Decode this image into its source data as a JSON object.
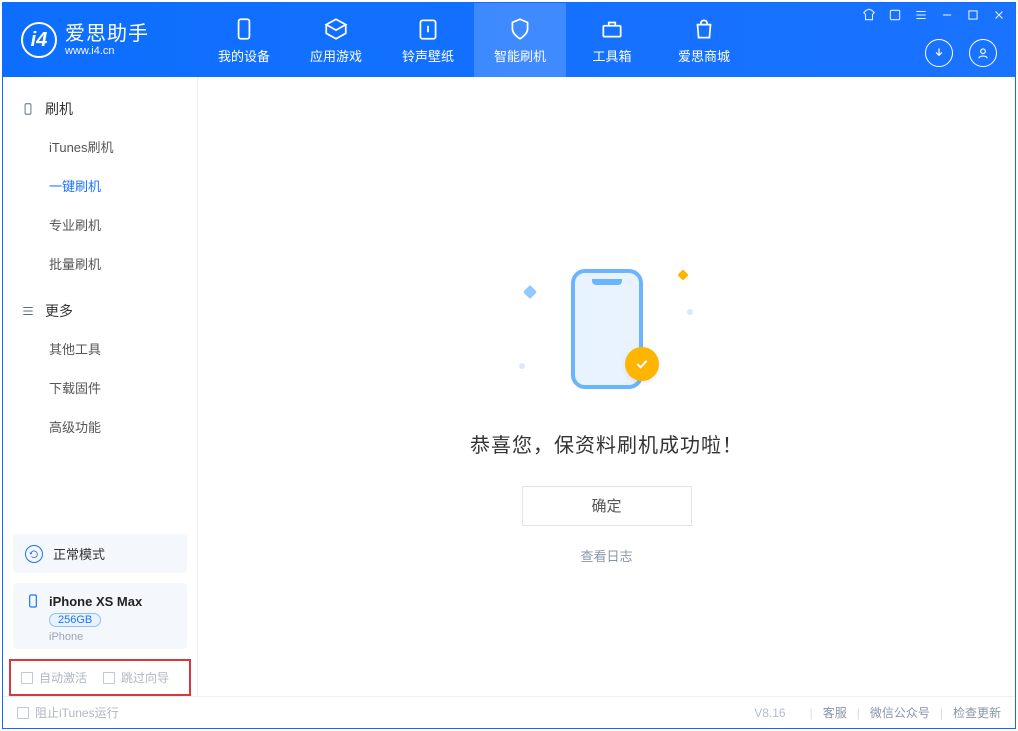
{
  "app": {
    "name_cn": "爱思助手",
    "name_en": "www.i4.cn"
  },
  "header": {
    "tabs": [
      {
        "label": "我的设备"
      },
      {
        "label": "应用游戏"
      },
      {
        "label": "铃声壁纸"
      },
      {
        "label": "智能刷机"
      },
      {
        "label": "工具箱"
      },
      {
        "label": "爱思商城"
      }
    ]
  },
  "sidebar": {
    "group1_title": "刷机",
    "group1_items": [
      "iTunes刷机",
      "一键刷机",
      "专业刷机",
      "批量刷机"
    ],
    "group2_title": "更多",
    "group2_items": [
      "其他工具",
      "下载固件",
      "高级功能"
    ],
    "mode": "正常模式",
    "device": {
      "name": "iPhone XS Max",
      "storage": "256GB",
      "type": "iPhone"
    },
    "auto_activate": "自动激活",
    "skip_wizard": "跳过向导"
  },
  "main": {
    "success_text": "恭喜您，保资料刷机成功啦！",
    "confirm": "确定",
    "view_log": "查看日志"
  },
  "statusbar": {
    "block_itunes": "阻止iTunes运行",
    "version": "V8.16",
    "links": [
      "客服",
      "微信公众号",
      "检查更新"
    ]
  }
}
